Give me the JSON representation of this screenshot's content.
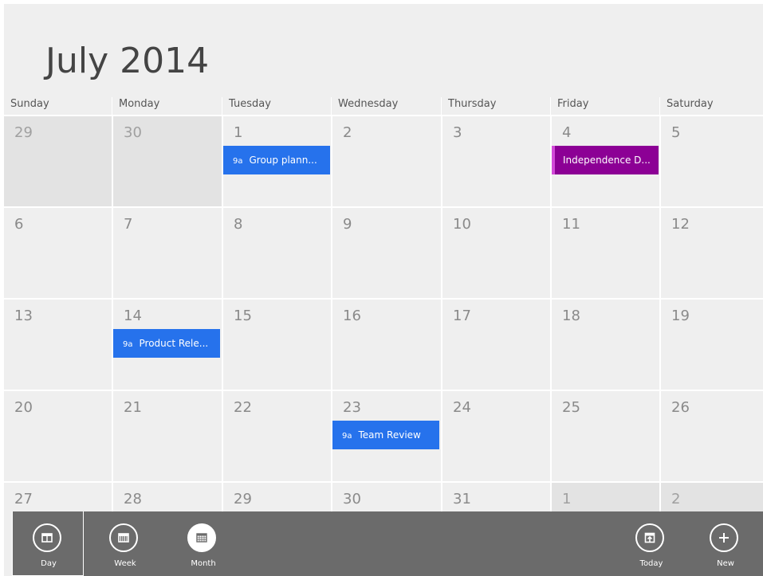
{
  "header": {
    "title": "July 2014"
  },
  "weekdays": [
    "Sunday",
    "Monday",
    "Tuesday",
    "Wednesday",
    "Thursday",
    "Friday",
    "Saturday"
  ],
  "weeks": [
    [
      {
        "day": "29",
        "other": true
      },
      {
        "day": "30",
        "other": true
      },
      {
        "day": "1",
        "event": {
          "time": "9a",
          "title": "Group plann...",
          "kind": "meeting"
        }
      },
      {
        "day": "2"
      },
      {
        "day": "3"
      },
      {
        "day": "4",
        "event": {
          "time": "",
          "title": "Independence D...",
          "kind": "holiday"
        }
      },
      {
        "day": "5"
      }
    ],
    [
      {
        "day": "6"
      },
      {
        "day": "7"
      },
      {
        "day": "8"
      },
      {
        "day": "9"
      },
      {
        "day": "10"
      },
      {
        "day": "11"
      },
      {
        "day": "12"
      }
    ],
    [
      {
        "day": "13"
      },
      {
        "day": "14",
        "event": {
          "time": "9a",
          "title": "Product Rele...",
          "kind": "meeting"
        }
      },
      {
        "day": "15"
      },
      {
        "day": "16"
      },
      {
        "day": "17"
      },
      {
        "day": "18"
      },
      {
        "day": "19"
      }
    ],
    [
      {
        "day": "20"
      },
      {
        "day": "21"
      },
      {
        "day": "22"
      },
      {
        "day": "23",
        "event": {
          "time": "9a",
          "title": "Team Review",
          "kind": "meeting"
        }
      },
      {
        "day": "24"
      },
      {
        "day": "25"
      },
      {
        "day": "26"
      }
    ],
    [
      {
        "day": "27"
      },
      {
        "day": "28"
      },
      {
        "day": "29"
      },
      {
        "day": "30"
      },
      {
        "day": "31"
      },
      {
        "day": "1",
        "other": true
      },
      {
        "day": "2",
        "other": true
      }
    ]
  ],
  "appbar": {
    "left": [
      {
        "label": "Day",
        "icon": "day-view-icon",
        "selected": true
      },
      {
        "label": "Week",
        "icon": "week-view-icon",
        "selected": false
      },
      {
        "label": "Month",
        "icon": "month-view-icon",
        "selected": false,
        "filled": true
      }
    ],
    "right": [
      {
        "label": "Today",
        "icon": "today-icon"
      },
      {
        "label": "New",
        "icon": "add-icon"
      }
    ]
  },
  "colors": {
    "event_blue": "#2672ec",
    "holiday_purple": "#8c0095",
    "appbar_bg": "#6b6b6b",
    "background": "#efefef"
  }
}
